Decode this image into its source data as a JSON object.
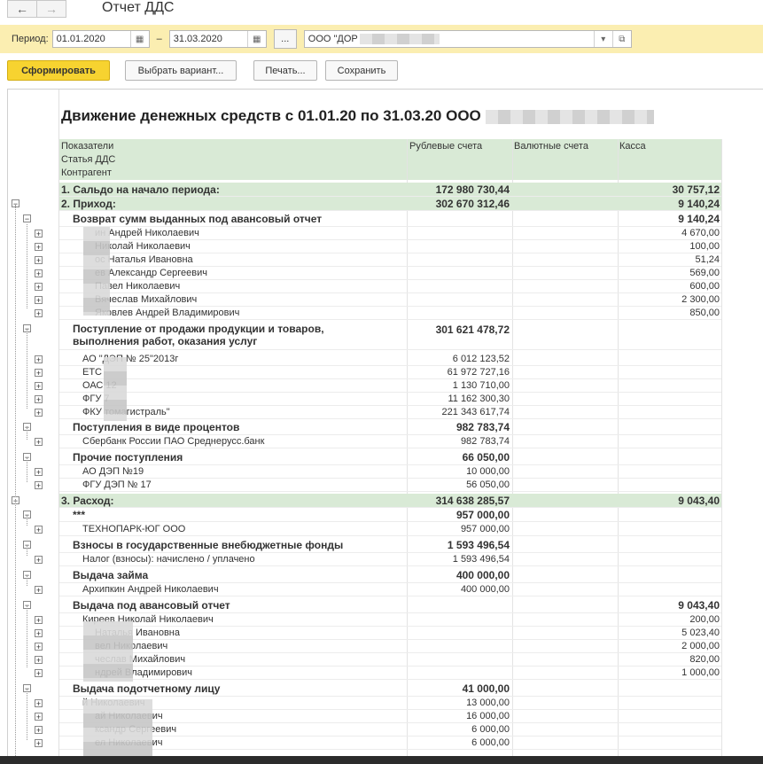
{
  "window": {
    "title": "Отчет ДДС"
  },
  "period": {
    "label": "Период:",
    "from": "01.01.2020",
    "dash": "–",
    "to": "31.03.2020",
    "dots_label": "...",
    "org": "ООО \"ДОР"
  },
  "toolbar": {
    "generate": "Сформировать",
    "variant": "Выбрать вариант...",
    "print": "Печать...",
    "save": "Сохранить"
  },
  "report": {
    "title": "Движение денежных средств с 01.01.20 по 31.03.20 ООО",
    "headers": {
      "pokazateli": "Показатели",
      "statya": "Статья ДДС",
      "kontragent": "Контрагент",
      "rub": "Рублевые счета",
      "val": "Валютные счета",
      "kassa": "Касса"
    }
  },
  "rows": [
    {
      "label": "1. Сальдо на начало периода:",
      "rub": "172 980 730,44",
      "kassa": "30 757,12"
    },
    {
      "label": "2. Приход:",
      "rub": "302 670 312,46",
      "kassa": "9 140,24"
    },
    {
      "label": "Возврат сумм выданных под авансовый отчет",
      "rub": "",
      "kassa": "9 140,24"
    },
    {
      "label": "ин Андрей Николаевич",
      "rub": "",
      "kassa": "4 670,00"
    },
    {
      "label": "Николай Николаевич",
      "rub": "",
      "kassa": "100,00"
    },
    {
      "label": "ос Наталья Ивановна",
      "rub": "",
      "kassa": "51,24"
    },
    {
      "label": "ев Александр Сергеевич",
      "rub": "",
      "kassa": "569,00"
    },
    {
      "label": "Павел Николаевич",
      "rub": "",
      "kassa": "600,00"
    },
    {
      "label": "Вячеслав Михайлович",
      "rub": "",
      "kassa": "2 300,00"
    },
    {
      "label": "Яковлев Андрей Владимирович",
      "rub": "",
      "kassa": "850,00"
    },
    {
      "label": "Поступление от продажи продукции и товаров,",
      "label2": "выполнения работ, оказания услуг",
      "rub": "301 621 478,72",
      "kassa": ""
    },
    {
      "label": "АО \"ДЭП № 25\"2013г",
      "rub": "6 012 123,52",
      "kassa": ""
    },
    {
      "label": "ЕТС",
      "rub": "61 972 727,16",
      "kassa": ""
    },
    {
      "label": "ОАС 12",
      "rub": "1 130 710,00",
      "kassa": ""
    },
    {
      "label": "ФГУ 7",
      "rub": "11 162 300,30",
      "kassa": ""
    },
    {
      "label": "ФКУ томагистраль\"",
      "rub": "221 343 617,74",
      "kassa": ""
    },
    {
      "label": "Поступления в виде процентов",
      "rub": "982 783,74",
      "kassa": ""
    },
    {
      "label": "Сбербанк России ПАО Среднерусс.банк",
      "rub": "982 783,74",
      "kassa": ""
    },
    {
      "label": "Прочие поступления",
      "rub": "66 050,00",
      "kassa": ""
    },
    {
      "label": "АО  ДЭП №19",
      "rub": "10 000,00",
      "kassa": ""
    },
    {
      "label": "ФГУ ДЭП № 17",
      "rub": "56 050,00",
      "kassa": ""
    },
    {
      "label": "3. Расход:",
      "rub": "314 638 285,57",
      "kassa": "9 043,40"
    },
    {
      "label": "***",
      "rub": "957 000,00",
      "kassa": ""
    },
    {
      "label": "ТЕХНОПАРК-ЮГ ООО",
      "rub": "957 000,00",
      "kassa": ""
    },
    {
      "label": "Взносы в государственные внебюджетные фонды",
      "rub": "1 593 496,54",
      "kassa": ""
    },
    {
      "label": "Налог (взносы): начислено / уплачено",
      "rub": "1 593 496,54",
      "kassa": ""
    },
    {
      "label": "Выдача займа",
      "rub": "400 000,00",
      "kassa": ""
    },
    {
      "label": "Архипкин Андрей Николаевич",
      "rub": "400 000,00",
      "kassa": ""
    },
    {
      "label": "Выдача под авансовый отчет",
      "rub": "",
      "kassa": "9 043,40"
    },
    {
      "label": "Киреев Николай Николаевич",
      "rub": "",
      "kassa": "200,00"
    },
    {
      "label": "Наталья Ивановна",
      "rub": "",
      "kassa": "5 023,40"
    },
    {
      "label": "вел Николаевич",
      "rub": "",
      "kassa": "2 000,00"
    },
    {
      "label": "чеслав Михайлович",
      "rub": "",
      "kassa": "820,00"
    },
    {
      "label": "ндрей Владимирович",
      "rub": "",
      "kassa": "1 000,00"
    },
    {
      "label": "Выдача подотчетному лицу",
      "rub": "41 000,00",
      "kassa": ""
    },
    {
      "label": "й Николаевич",
      "rub": "13 000,00",
      "kassa": ""
    },
    {
      "label": "ай Николаевич",
      "rub": "16 000,00",
      "kassa": ""
    },
    {
      "label": "ксандр Сергеевич",
      "rub": "6 000,00",
      "kassa": ""
    },
    {
      "label": "ел Николаевич",
      "rub": "6 000,00",
      "kassa": ""
    }
  ]
}
